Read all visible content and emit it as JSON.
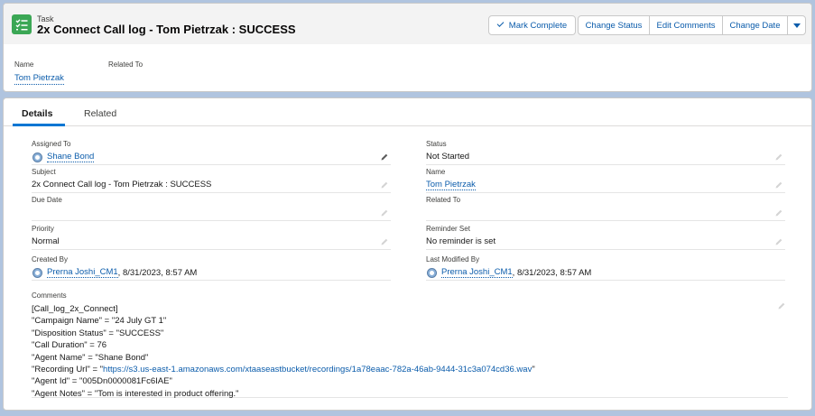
{
  "header": {
    "object_label": "Task",
    "title": "2x Connect Call log - Tom Pietrzak : SUCCESS",
    "icon": "task-checklist-icon",
    "accent_color": "#3ba755",
    "actions": {
      "mark_complete": "Mark Complete",
      "change_status": "Change Status",
      "edit_comments": "Edit Comments",
      "change_date": "Change Date"
    },
    "highlights": {
      "name_label": "Name",
      "name_value": "Tom Pietrzak",
      "related_label": "Related To"
    }
  },
  "tabs": {
    "details": "Details",
    "related": "Related"
  },
  "fields": {
    "assigned_to": {
      "label": "Assigned To",
      "value": "Shane Bond"
    },
    "status": {
      "label": "Status",
      "value": "Not Started"
    },
    "subject": {
      "label": "Subject",
      "value": "2x Connect Call log - Tom Pietrzak : SUCCESS"
    },
    "name": {
      "label": "Name",
      "value": "Tom Pietrzak"
    },
    "due_date": {
      "label": "Due Date",
      "value": ""
    },
    "related_to": {
      "label": "Related To",
      "value": ""
    },
    "priority": {
      "label": "Priority",
      "value": "Normal"
    },
    "reminder_set": {
      "label": "Reminder Set",
      "value": "No reminder is set"
    },
    "created_by": {
      "label": "Created By",
      "user": "Prerna Joshi_CM1",
      "date": ", 8/31/2023, 8:57 AM"
    },
    "last_modified_by": {
      "label": "Last Modified By",
      "user": "Prerna Joshi_CM1",
      "date": ", 8/31/2023, 8:57 AM"
    }
  },
  "comments": {
    "label": "Comments",
    "lines": [
      "[Call_log_2x_Connect]",
      "\"Campaign Name\" = \"24 July GT 1\"",
      "\"Disposition Status\" = \"SUCCESS\"",
      "\"Call Duration\" = 76",
      "\"Agent Name\" = \"Shane Bond\""
    ],
    "recording_prefix": "\"Recording Url\" = \"",
    "recording_url": "https://s3.us-east-1.amazonaws.com/xtaaseastbucket/recordings/1a78eaac-782a-46ab-9444-31c3a074cd36.wav",
    "recording_suffix": "\"",
    "after_lines": [
      "\"Agent Id\" = \"005Dn0000081Fc6IAE\"",
      "\"Agent Notes\" = \"Tom is interested in product offering.\""
    ]
  }
}
